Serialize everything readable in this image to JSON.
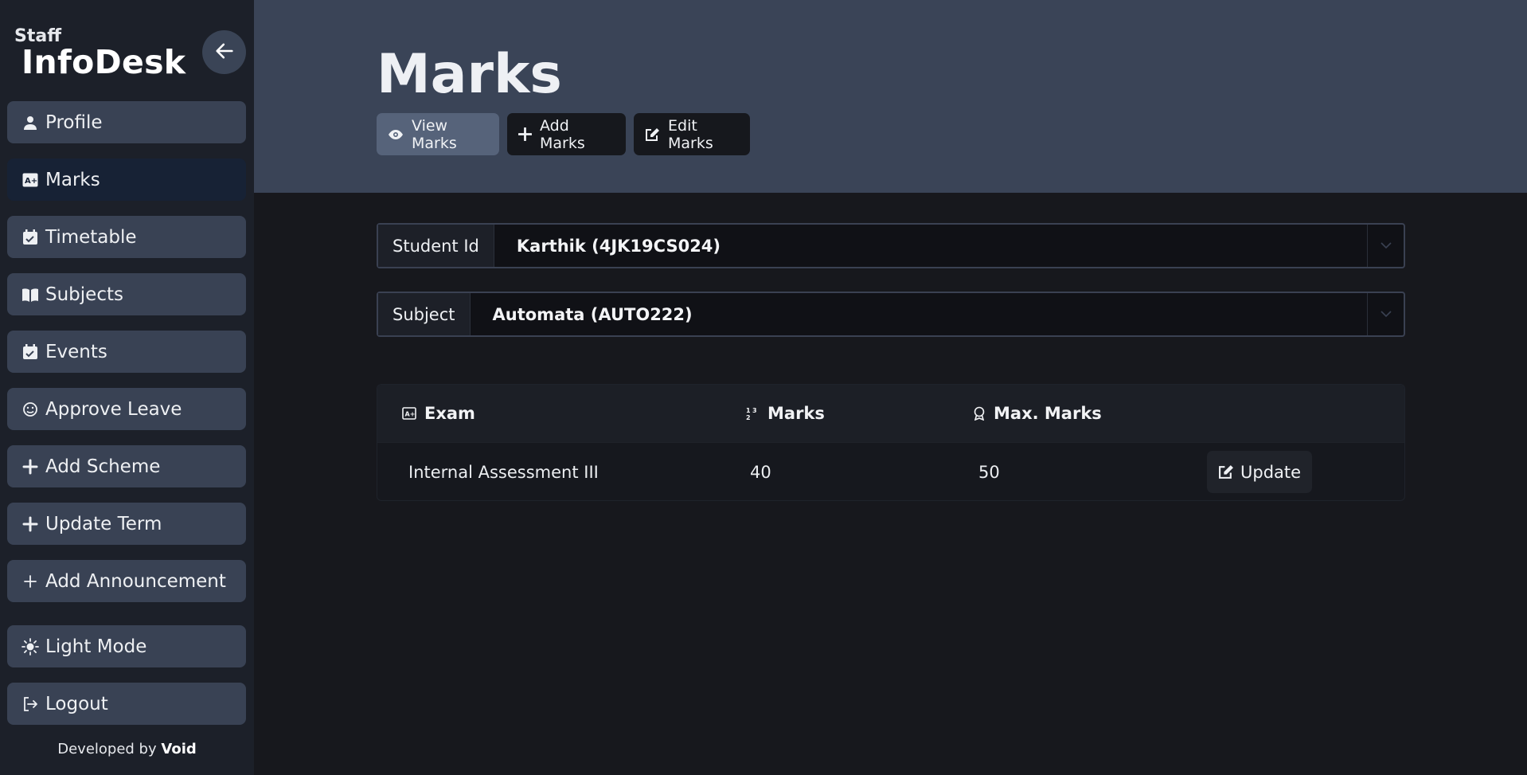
{
  "sidebar": {
    "brand_small": "Staff",
    "brand_big": "InfoDesk",
    "items": [
      {
        "label": "Profile",
        "icon": "user-icon"
      },
      {
        "label": "Marks",
        "icon": "grade-icon"
      },
      {
        "label": "Timetable",
        "icon": "calendar-check-icon"
      },
      {
        "label": "Subjects",
        "icon": "book-icon"
      },
      {
        "label": "Events",
        "icon": "calendar-check-icon"
      },
      {
        "label": "Approve Leave",
        "icon": "leave-icon"
      },
      {
        "label": "Add Scheme",
        "icon": "plus-icon"
      },
      {
        "label": "Update Term",
        "icon": "plus-icon"
      },
      {
        "label": "Add Announcement",
        "icon": "plus-icon"
      }
    ],
    "mode_label": "Light Mode",
    "logout_label": "Logout",
    "footer_prefix": "Developed by",
    "footer_author": "Void"
  },
  "header": {
    "title": "Marks",
    "tabs": [
      {
        "label": "View Marks",
        "icon": "eye-icon"
      },
      {
        "label": "Add Marks",
        "icon": "plus-icon"
      },
      {
        "label": "Edit Marks",
        "icon": "edit-icon"
      }
    ]
  },
  "filters": {
    "student_label": "Student Id",
    "student_value": "Karthik (4JK19CS024)",
    "subject_label": "Subject",
    "subject_value": "Automata (AUTO222)"
  },
  "table": {
    "headers": [
      "Exam",
      "Marks",
      "Max. Marks"
    ],
    "rows": [
      {
        "exam": "Internal Assessment III",
        "marks": "40",
        "max": "50",
        "action": "Update"
      }
    ]
  },
  "colors": {
    "sidebar_bg": "#1c2029",
    "nav_bg": "#394254",
    "nav_active_bg": "#172235",
    "header_bg": "#3a4457",
    "page_bg": "#17181d"
  }
}
